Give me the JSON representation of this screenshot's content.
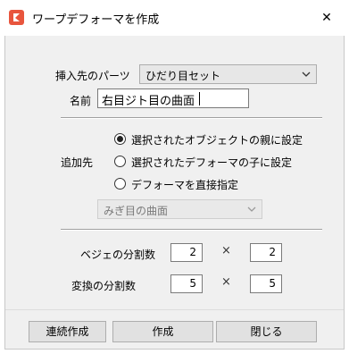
{
  "window": {
    "title": "ワープデフォーマを作成",
    "close_symbol": "✕"
  },
  "form": {
    "insert_label": "挿入先のパーツ",
    "insert_value": "ひだり目セット",
    "name_label": "名前",
    "name_value": "右目ジト目の曲面"
  },
  "add_to": {
    "label": "追加先",
    "options": [
      {
        "label": "選択されたオブジェクトの親に設定",
        "selected": true
      },
      {
        "label": "選択されたデフォーマの子に設定",
        "selected": false
      },
      {
        "label": "デフォーマを直接指定",
        "selected": false
      }
    ],
    "deformer_select_value": "みぎ目の曲面"
  },
  "divisions": {
    "bezier_label": "ベジェの分割数",
    "bezier_x": "2",
    "bezier_y": "2",
    "transform_label": "変換の分割数",
    "transform_x": "5",
    "transform_y": "5",
    "times_symbol": "×"
  },
  "buttons": {
    "continuous": "連続作成",
    "create": "作成",
    "close": "閉じる"
  },
  "colors": {
    "app_icon": "#e8553d"
  }
}
